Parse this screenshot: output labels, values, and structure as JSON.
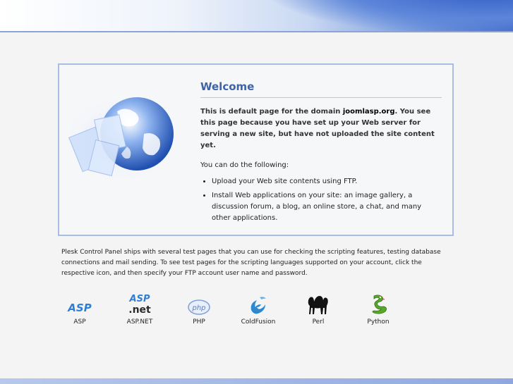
{
  "welcome": {
    "title": "Welcome",
    "intro_before": "This is default page for the domain ",
    "domain": "joomlasp.org",
    "intro_after": ". You see this page because you have set up your Web server for serving a new site, but have not uploaded the site content yet.",
    "can_do": "You can do the following:",
    "actions": [
      "Upload your Web site contents using FTP.",
      "Install Web applications on your site: an image gallery, a discussion forum, a blog, an online store, a chat, and many other applications."
    ]
  },
  "description": "Plesk Control Panel ships with several test pages that you can use for checking the scripting features, testing database connections and mail sending. To see test pages for the scripting languages supported on your account, click the respective icon, and then specify your FTP account user name and password.",
  "languages": [
    {
      "label": "ASP",
      "icon": "asp-icon"
    },
    {
      "label": "ASP.NET",
      "icon": "aspnet-icon"
    },
    {
      "label": "PHP",
      "icon": "php-icon"
    },
    {
      "label": "ColdFusion",
      "icon": "coldfusion-icon"
    },
    {
      "label": "Perl",
      "icon": "perl-camel-icon"
    },
    {
      "label": "Python",
      "icon": "python-snake-icon"
    }
  ],
  "icon_text": {
    "asp": "ASP",
    "aspnet_top": "ASP",
    "aspnet_bottom": ".net",
    "php": "php"
  },
  "colors": {
    "title": "#3d63a8",
    "box_border": "#a9bde2",
    "banner_blue": "#3f69c8"
  }
}
